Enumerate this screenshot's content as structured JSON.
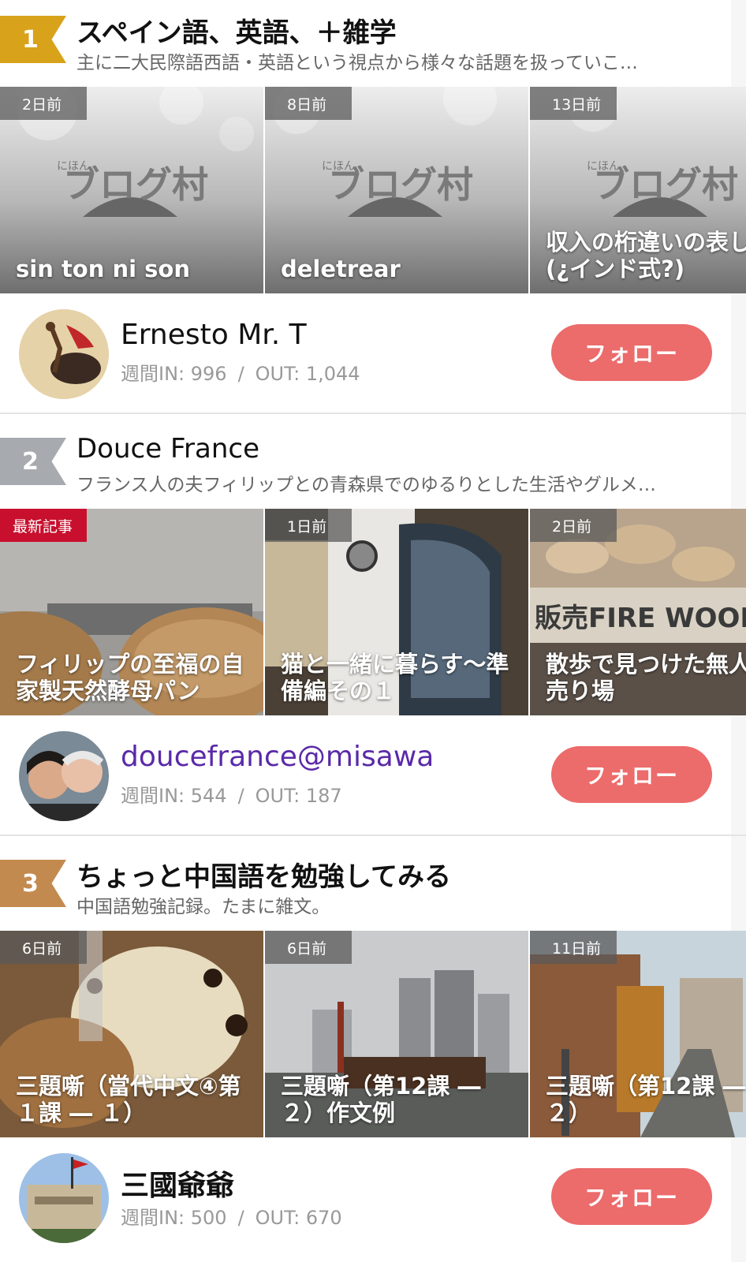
{
  "rankings": [
    {
      "rank": "1",
      "badge_color": "#d9a21b",
      "title": "スペイン語、英語、＋雑学",
      "description": "主に二大民際語西語・英語という視点から様々な話題を扱っていこ…",
      "posts": [
        {
          "time": "2日前",
          "title": "sin ton ni son",
          "image": "nihon-blog-mura-logo"
        },
        {
          "time": "8日前",
          "title": "deletrear",
          "image": "nihon-blog-mura-logo"
        },
        {
          "time": "13日前",
          "title": "収入の桁違いの表し(¿インド式?)",
          "image": "nihon-blog-mura-logo"
        }
      ],
      "logo_text_small": "にほん",
      "logo_text": "ブログ村",
      "author": {
        "name": "Ernesto Mr. T",
        "weekly_in": "週間IN: 996",
        "out": "OUT: 1,044",
        "avatar": "bullfighter-avatar"
      },
      "follow_label": "フォロー"
    },
    {
      "rank": "2",
      "badge_color": "#a7abb0",
      "title": "Douce France",
      "description": "フランス人の夫フィリップとの青森県でのゆるりとした生活やグルメ…",
      "posts": [
        {
          "time": "最新記事",
          "title": "フィリップの至福の自家製天然酵母パン",
          "image": "bread-photo"
        },
        {
          "time": "1日前",
          "title": "猫と一緒に暮らす〜準備編その１",
          "image": "stove-photo"
        },
        {
          "time": "2日前",
          "title": "散歩で見つけた無人売り場",
          "image": "firewood-photo"
        }
      ],
      "firewood_sign": "販売FIRE WOOD SALE",
      "author": {
        "name": "doucefrance@misawa",
        "weekly_in": "週間IN: 544",
        "out": "OUT: 187",
        "avatar": "couple-avatar"
      },
      "follow_label": "フォロー"
    },
    {
      "rank": "3",
      "badge_color": "#c38a4f",
      "title": "ちょっと中国語を勉強してみる",
      "description": "中国語勉強記録。たまに雑文。",
      "posts": [
        {
          "time": "6日前",
          "title": "三題噺（當代中文④第１課 ― １）",
          "image": "food-photo"
        },
        {
          "time": "6日前",
          "title": "三題噺（第12課 ― ２）作文例",
          "image": "city-river-photo"
        },
        {
          "time": "11日前",
          "title": "三題噺（第12課 ― ２）",
          "image": "street-photo"
        }
      ],
      "author": {
        "name": "三國爺爺",
        "weekly_in": "週間IN: 500",
        "out": "OUT: 670",
        "avatar": "building-flag-avatar"
      },
      "follow_label": "フォロー"
    }
  ],
  "separator": "/"
}
